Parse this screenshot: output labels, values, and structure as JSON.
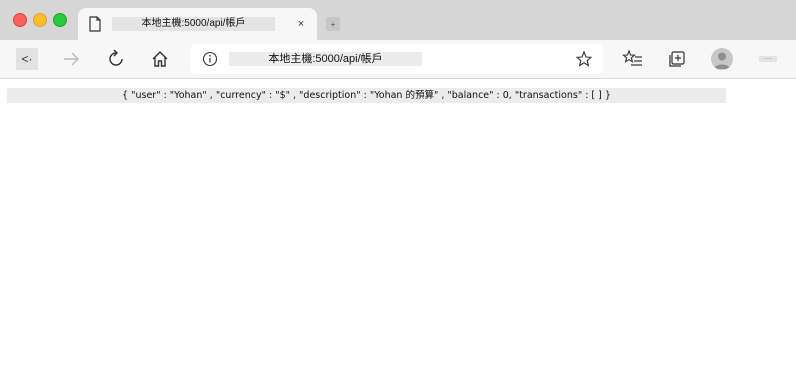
{
  "tab": {
    "title": "本地主機:5000/api/帳戶",
    "close_glyph": "×",
    "new_tab_glyph": "+"
  },
  "toolbar": {
    "back_glyph": "<·",
    "url": "本地主機:5000/api/帳戶",
    "more_glyph": "···"
  },
  "content": {
    "json_text": "{ \"user\" : \"Yohan\" , \"currency\" : \"$\" , \"description\" : \"Yohan 的預算\" , \"balance\" : 0, \"transactions\" : [ ] }"
  },
  "icons": {
    "tab": "page-icon",
    "forward": "arrow-right-icon",
    "refresh": "refresh-icon",
    "home": "home-icon",
    "info": "info-icon",
    "favorite": "star-icon",
    "favorites": "favorites-list-icon",
    "collections": "collections-icon",
    "profile": "avatar-icon"
  },
  "colors": {
    "tabstrip": "#d6d6d6",
    "toolbar": "#f7f7f7",
    "close": "#fe5f57",
    "minimize": "#febc2e",
    "maximize": "#28c840"
  }
}
